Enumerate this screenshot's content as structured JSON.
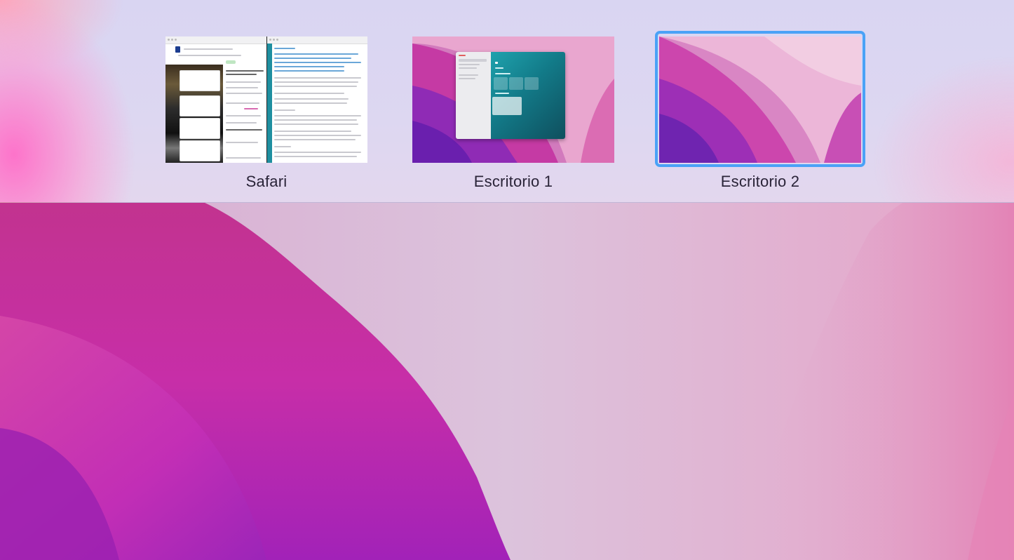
{
  "mission_control": {
    "spaces": [
      {
        "label": "Safari",
        "selected": false
      },
      {
        "label": "Escritorio 1",
        "selected": false
      },
      {
        "label": "Escritorio 2",
        "selected": true
      }
    ]
  },
  "colors": {
    "selection_border": "#4aa2f7",
    "label_text": "#2a2438"
  },
  "icons": []
}
